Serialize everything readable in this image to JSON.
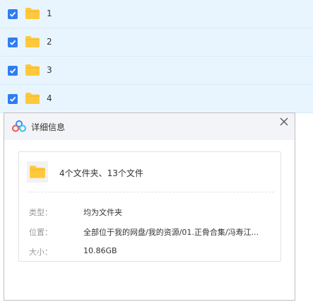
{
  "file_list": [
    {
      "name": "1",
      "checked": true
    },
    {
      "name": "2",
      "checked": true
    },
    {
      "name": "3",
      "checked": true
    },
    {
      "name": "4",
      "checked": true
    }
  ],
  "dialog": {
    "title": "详细信息",
    "summary": "4个文件夹、13个文件",
    "details": [
      {
        "label": "类型：",
        "value": "均为文件夹"
      },
      {
        "label": "位置：",
        "value": "全部位于我的网盘/我的资源/01.正骨合集/冯寿江..."
      },
      {
        "label": "大小：",
        "value": "10.86GB"
      }
    ]
  },
  "colors": {
    "row_bg": "#e9f5fe",
    "checkbox": "#2f7df4",
    "folder": "#ffc93d",
    "header_bg": "#f3f4f7"
  }
}
